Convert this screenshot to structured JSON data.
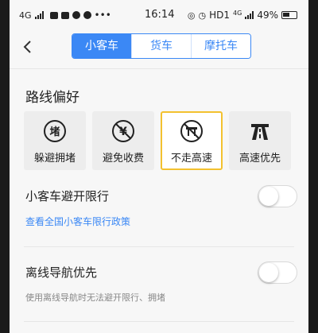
{
  "status_bar": {
    "network": "4G",
    "time": "16:14",
    "hd": "HD1",
    "network_right": "4G",
    "battery_pct": "49%"
  },
  "header": {
    "tabs": [
      {
        "label": "小客车",
        "active": true
      },
      {
        "label": "货车",
        "active": false
      },
      {
        "label": "摩托车",
        "active": false
      }
    ]
  },
  "route_pref": {
    "title": "路线偏好",
    "options": [
      {
        "label": "躲避拥堵",
        "icon": "avoid-congestion-icon",
        "selected": false
      },
      {
        "label": "避免收费",
        "icon": "avoid-toll-icon",
        "selected": false
      },
      {
        "label": "不走高速",
        "icon": "no-highway-icon",
        "selected": true
      },
      {
        "label": "高速优先",
        "icon": "highway-first-icon",
        "selected": false
      }
    ]
  },
  "settings": {
    "restriction": {
      "title": "小客车避开限行",
      "link": "查看全国小客车限行政策",
      "enabled": false
    },
    "offline": {
      "title": "离线导航优先",
      "desc": "使用离线导航时无法避开限行、拥堵",
      "enabled": false
    }
  },
  "colors": {
    "accent": "#3b88f5",
    "selected_border": "#f3c12f"
  }
}
